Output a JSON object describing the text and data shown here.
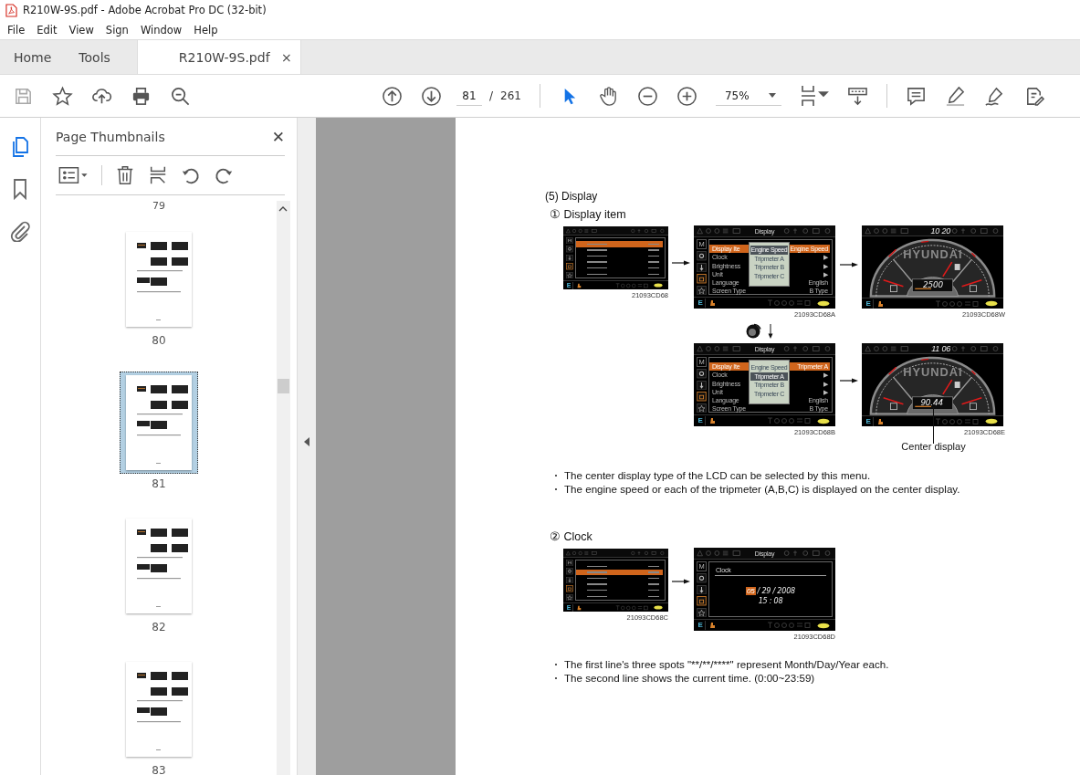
{
  "window": {
    "title": "R210W-9S.pdf - Adobe Acrobat Pro DC (32-bit)"
  },
  "menu_bar": [
    "File",
    "Edit",
    "View",
    "Sign",
    "Window",
    "Help"
  ],
  "tabs": [
    {
      "label": "Home",
      "selected": false,
      "closable": false
    },
    {
      "label": "Tools",
      "selected": false,
      "closable": false
    },
    {
      "label": "R210W-9S.pdf",
      "selected": true,
      "closable": true,
      "close_glyph": "×"
    }
  ],
  "toolbar": {
    "page_number": "81",
    "page_separator": "/",
    "page_count": "261",
    "zoom": "75%"
  },
  "side_panel": {
    "title": "Page Thumbnails",
    "close_glyph": "✕",
    "rail": [
      {
        "kind": "pages",
        "selected": true
      },
      {
        "kind": "bookmarks",
        "selected": false
      },
      {
        "kind": "attachments",
        "selected": false
      }
    ],
    "cut_label": "79",
    "thumbnails": [
      {
        "label": "80",
        "selected": false
      },
      {
        "label": "81",
        "selected": true
      },
      {
        "label": "82",
        "selected": false
      },
      {
        "label": "83",
        "selected": false
      }
    ]
  },
  "document": {
    "heading": "(5) Display",
    "sections": [
      {
        "title": "① Display item",
        "callout": "Center display",
        "screens": [
          {
            "kind": "mini_menu",
            "mode": "E",
            "caption": "21093CD68",
            "rows": [
              {
                "selected": true
              },
              {
                "selected": false
              },
              {
                "selected": false
              },
              {
                "selected": false
              },
              {
                "selected": false
              },
              {
                "selected": false
              }
            ]
          },
          {
            "kind": "menu",
            "title": "Display",
            "side_label": "M",
            "mode": "E",
            "caption": "21093CD68A",
            "items": [
              {
                "label": "Display Ite",
                "value": "Engine Speed",
                "selected": true
              },
              {
                "label": "Clock",
                "value": "▶",
                "selected": false
              },
              {
                "label": "Brightness",
                "value": "▶",
                "selected": false
              },
              {
                "label": "Unit",
                "value": "▶",
                "selected": false
              },
              {
                "label": "Language",
                "value": "English",
                "selected": false
              },
              {
                "label": "Screen Type",
                "value": "B Type",
                "selected": false
              }
            ],
            "popup": [
              {
                "label": "Engine Speed",
                "selected": true
              },
              {
                "label": "Tripmeter A",
                "selected": false
              },
              {
                "label": "Tripmeter B",
                "selected": false
              },
              {
                "label": "Tripmeter C",
                "selected": false
              }
            ]
          },
          {
            "kind": "gauge",
            "mode": "E",
            "caption": "21093CD68W",
            "clock": "10 20",
            "brand": "HYUNDAI",
            "reading": "2500"
          },
          {
            "kind": "menu",
            "title": "Display",
            "side_label": "M",
            "mode": "E",
            "caption": "21093CD68B",
            "items": [
              {
                "label": "Display Ite",
                "value": "Tripmeter  A",
                "selected": true
              },
              {
                "label": "Clock",
                "value": "▶",
                "selected": false
              },
              {
                "label": "Brightness",
                "value": "▶",
                "selected": false
              },
              {
                "label": "Unit",
                "value": "▶",
                "selected": false
              },
              {
                "label": "Language",
                "value": "English",
                "selected": false
              },
              {
                "label": "Screen Type",
                "value": "B Type",
                "selected": false
              }
            ],
            "popup": [
              {
                "label": "Engine Speed",
                "selected": false
              },
              {
                "label": "Tripmeter A",
                "selected": true
              },
              {
                "label": "Tripmeter B",
                "selected": false
              },
              {
                "label": "Tripmeter C",
                "selected": false
              }
            ]
          },
          {
            "kind": "gauge",
            "mode": "E",
            "caption": "21093CD68E",
            "clock": "11 06",
            "brand": "HYUNDAI",
            "reading": "90.44"
          }
        ],
        "bullets": [
          "The center display type of the LCD can be selected by this menu.",
          "The engine speed or each of the tripmeter (A,B,C) is displayed on the center display."
        ]
      },
      {
        "title": "② Clock",
        "screens": [
          {
            "kind": "mini_menu",
            "mode": "E",
            "caption": "21093CD68C",
            "rows": [
              {
                "selected": false
              },
              {
                "selected": true
              },
              {
                "selected": false
              },
              {
                "selected": false
              },
              {
                "selected": false
              },
              {
                "selected": false
              }
            ]
          },
          {
            "kind": "clock",
            "title": "Display",
            "side_label": "M",
            "mode": "E",
            "caption": "21093CD68D",
            "heading": "Clock",
            "date_field": "05",
            "date_rest": "/ 29 / 2008",
            "time": "15 : 08"
          }
        ],
        "bullets": [
          "The first line's three spots \"**/**/****\" represent Month/Day/Year each.",
          "The second line shows the current time. (0:00~23:59)"
        ]
      }
    ]
  }
}
